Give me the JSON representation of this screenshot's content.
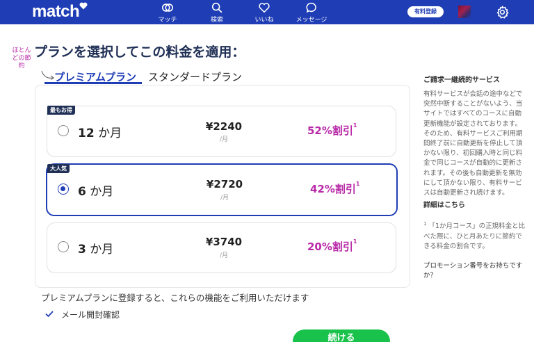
{
  "header": {
    "logo": "match",
    "nav": [
      {
        "label": "マッチ",
        "icon": "rings-icon"
      },
      {
        "label": "検索",
        "icon": "search-icon"
      },
      {
        "label": "いいね",
        "icon": "heart-icon"
      },
      {
        "label": "メッセージ",
        "icon": "chat-bubble-icon"
      }
    ],
    "register_label": "有料登録",
    "settings_icon": "gear-icon"
  },
  "annotation": "ほとんどの節約",
  "page_title": "プランを選択してこの料金を適用：",
  "tabs": [
    {
      "label": "プレミアムプラン",
      "active": true
    },
    {
      "label": "スタンダードプラン",
      "active": false
    }
  ],
  "plans": [
    {
      "badge": "最もお得",
      "months": "12",
      "unit": "か月",
      "price": "¥2240",
      "per": "/月",
      "discount": "52%割引",
      "footnote": "1",
      "selected": false
    },
    {
      "badge": "大人気",
      "months": "6",
      "unit": "か月",
      "price": "¥2720",
      "per": "/月",
      "discount": "42%割引",
      "footnote": "1",
      "selected": true
    },
    {
      "badge": "",
      "months": "3",
      "unit": "か月",
      "price": "¥3740",
      "per": "/月",
      "discount": "20%割引",
      "footnote": "1",
      "selected": false
    }
  ],
  "features": {
    "intro": "プレミアムプランに登録すると、これらの機能をご利用いただけます",
    "items": [
      "メール開封確認"
    ]
  },
  "continue_label": "続ける",
  "sidebar": {
    "title": "ご請求一継続的サービス",
    "body": "有料サービスが会話の途中などで突然中断することがないよう、当サイトではすべてのコースに自動更新機能が設定されております。そのため、有料サービスご利用期間終了前に自動更新を停止して頂かない限り、初回購入時と同じ料金で同じコースが自動的に更新されます。その後も自動更新を無効にして頂かない限り、有料サービスは自動更新され続けます。",
    "details_link": "詳細はこちら",
    "footnote_mark": "1",
    "footnote": "「1か月コース」の正規料金と比べた際に、ひと月あたりに節約できる料金の割合です。",
    "promo": "プロモーション番号をお持ちですか？"
  },
  "colors": {
    "brand_blue": "#1f3db5",
    "discount_magenta": "#b82aa8",
    "continue_green": "#19c24b",
    "title_navy": "#1f2f55"
  }
}
